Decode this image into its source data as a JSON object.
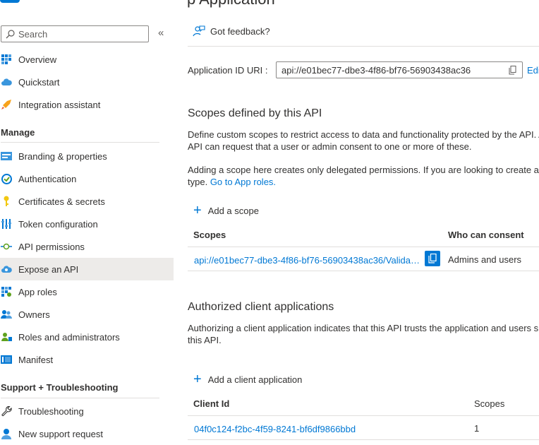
{
  "header": {
    "title_partial": "p Application"
  },
  "search": {
    "placeholder": "Search"
  },
  "sidebar": {
    "items": [
      {
        "label": "Overview"
      },
      {
        "label": "Quickstart"
      },
      {
        "label": "Integration assistant"
      }
    ],
    "manage_heading": "Manage",
    "manage_items": [
      {
        "label": "Branding & properties"
      },
      {
        "label": "Authentication"
      },
      {
        "label": "Certificates & secrets"
      },
      {
        "label": "Token configuration"
      },
      {
        "label": "API permissions"
      },
      {
        "label": "Expose an API"
      },
      {
        "label": "App roles"
      },
      {
        "label": "Owners"
      },
      {
        "label": "Roles and administrators"
      },
      {
        "label": "Manifest"
      }
    ],
    "support_heading": "Support + Troubleshooting",
    "support_items": [
      {
        "label": "Troubleshooting"
      },
      {
        "label": "New support request"
      }
    ]
  },
  "main": {
    "feedback": "Got feedback?",
    "app_id_label": "Application ID URI :",
    "app_id_value": "api://e01bec77-dbe3-4f86-bf76-56903438ac36",
    "edit_label": "Edi",
    "scopes_heading": "Scopes defined by this API",
    "scopes_desc_line1": "Define custom scopes to restrict access to data and functionality protected by the API. A",
    "scopes_desc_line2": "API can request that a user or admin consent to one or more of these.",
    "scopes_note_line1": "Adding a scope here creates only delegated permissions. If you are looking to create app",
    "scopes_note_line2_prefix": "type.",
    "scopes_note_link": "Go to App roles.",
    "add_scope": "Add a scope",
    "scopes_table": {
      "col_scopes": "Scopes",
      "col_consent": "Who can consent",
      "rows": [
        {
          "scope": "api://e01bec77-dbe3-4f86-bf76-56903438ac36/Valida…",
          "consent": "Admins and users"
        }
      ]
    },
    "clients_heading": "Authorized client applications",
    "clients_desc_line1": "Authorizing a client application indicates that this API trusts the application and users s",
    "clients_desc_line2": "this API.",
    "add_client": "Add a client application",
    "clients_table": {
      "col_client_id": "Client Id",
      "col_scopes": "Scopes",
      "rows": [
        {
          "client_id": "04f0c124-f2bc-4f59-8241-bf6df9866bbd",
          "scopes": "1"
        }
      ]
    }
  },
  "colors": {
    "accent": "#0078d4",
    "active_bg": "#edebe9",
    "text": "#323130",
    "divider": "#e1dfdd"
  }
}
